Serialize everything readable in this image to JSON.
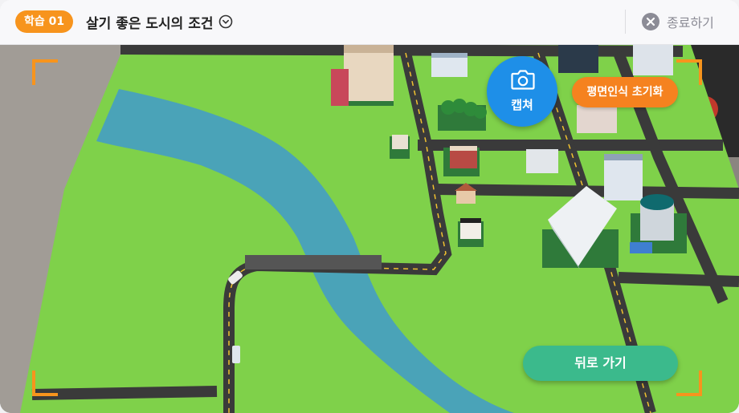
{
  "header": {
    "badge": "학습 01",
    "title": "살기 좋은 도시의 조건",
    "exit_label": "종료하기"
  },
  "buttons": {
    "capture_label": "캡쳐",
    "reset_label": "평면인식 초기화",
    "back_label": "뒤로 가기"
  },
  "colors": {
    "badge": "#f7941d",
    "capture": "#1e8fe8",
    "reset": "#f5821f",
    "back": "#3bba8c",
    "corner_brackets": "#f7941d",
    "grass": "#7fd14a",
    "river": "#4aa3b8",
    "road": "#3a3a3a"
  },
  "icons": {
    "title_toggle": "chevron-down-circle-icon",
    "exit": "close-circle-icon",
    "capture": "camera-icon"
  }
}
